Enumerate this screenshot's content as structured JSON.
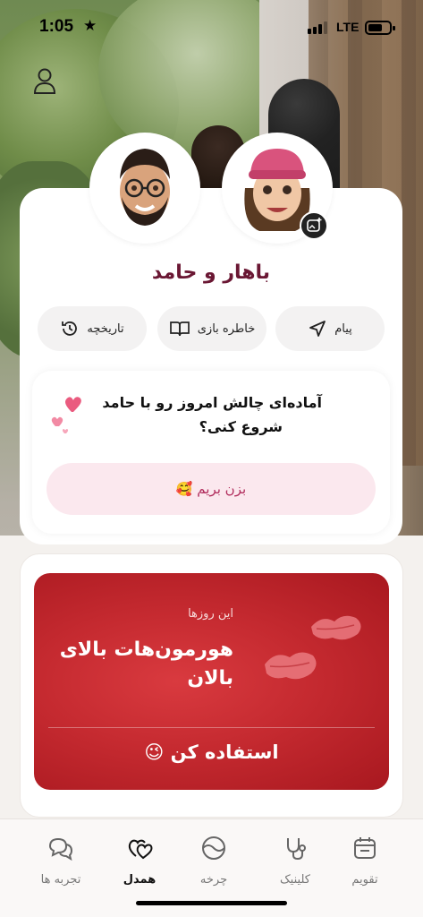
{
  "status_bar": {
    "time": "1:05",
    "network": "LTE"
  },
  "couple": {
    "names": "باهار و حامد"
  },
  "actions": [
    {
      "label": "پیام",
      "icon": "send-icon"
    },
    {
      "label": "خاطره بازی",
      "icon": "book-icon"
    },
    {
      "label": "تاریخچه",
      "icon": "history-icon"
    }
  ],
  "challenge": {
    "line1": "آماده‌ای چالش امروز رو با حامد",
    "line2": "شروع کنی؟",
    "button_label": "بزن بریم 🥰"
  },
  "hormone_card": {
    "eyebrow": "این روزها",
    "title": "هورمون‌هات بالای بالان",
    "cta": "استفاده کن 😉"
  },
  "tabs": [
    {
      "label": "تقویم",
      "icon": "calendar-icon",
      "active": false
    },
    {
      "label": "کلینیک",
      "icon": "stethoscope-icon",
      "active": false
    },
    {
      "label": "چرخه",
      "icon": "cycle-icon",
      "active": false
    },
    {
      "label": "همدل",
      "icon": "hearts-icon",
      "active": true
    },
    {
      "label": "تجربه ها",
      "icon": "chat-bubbles-icon",
      "active": false
    }
  ],
  "colors": {
    "accent": "#6a1733",
    "brand_red": "#c52a30",
    "button_pink": "#fbe8ee"
  }
}
